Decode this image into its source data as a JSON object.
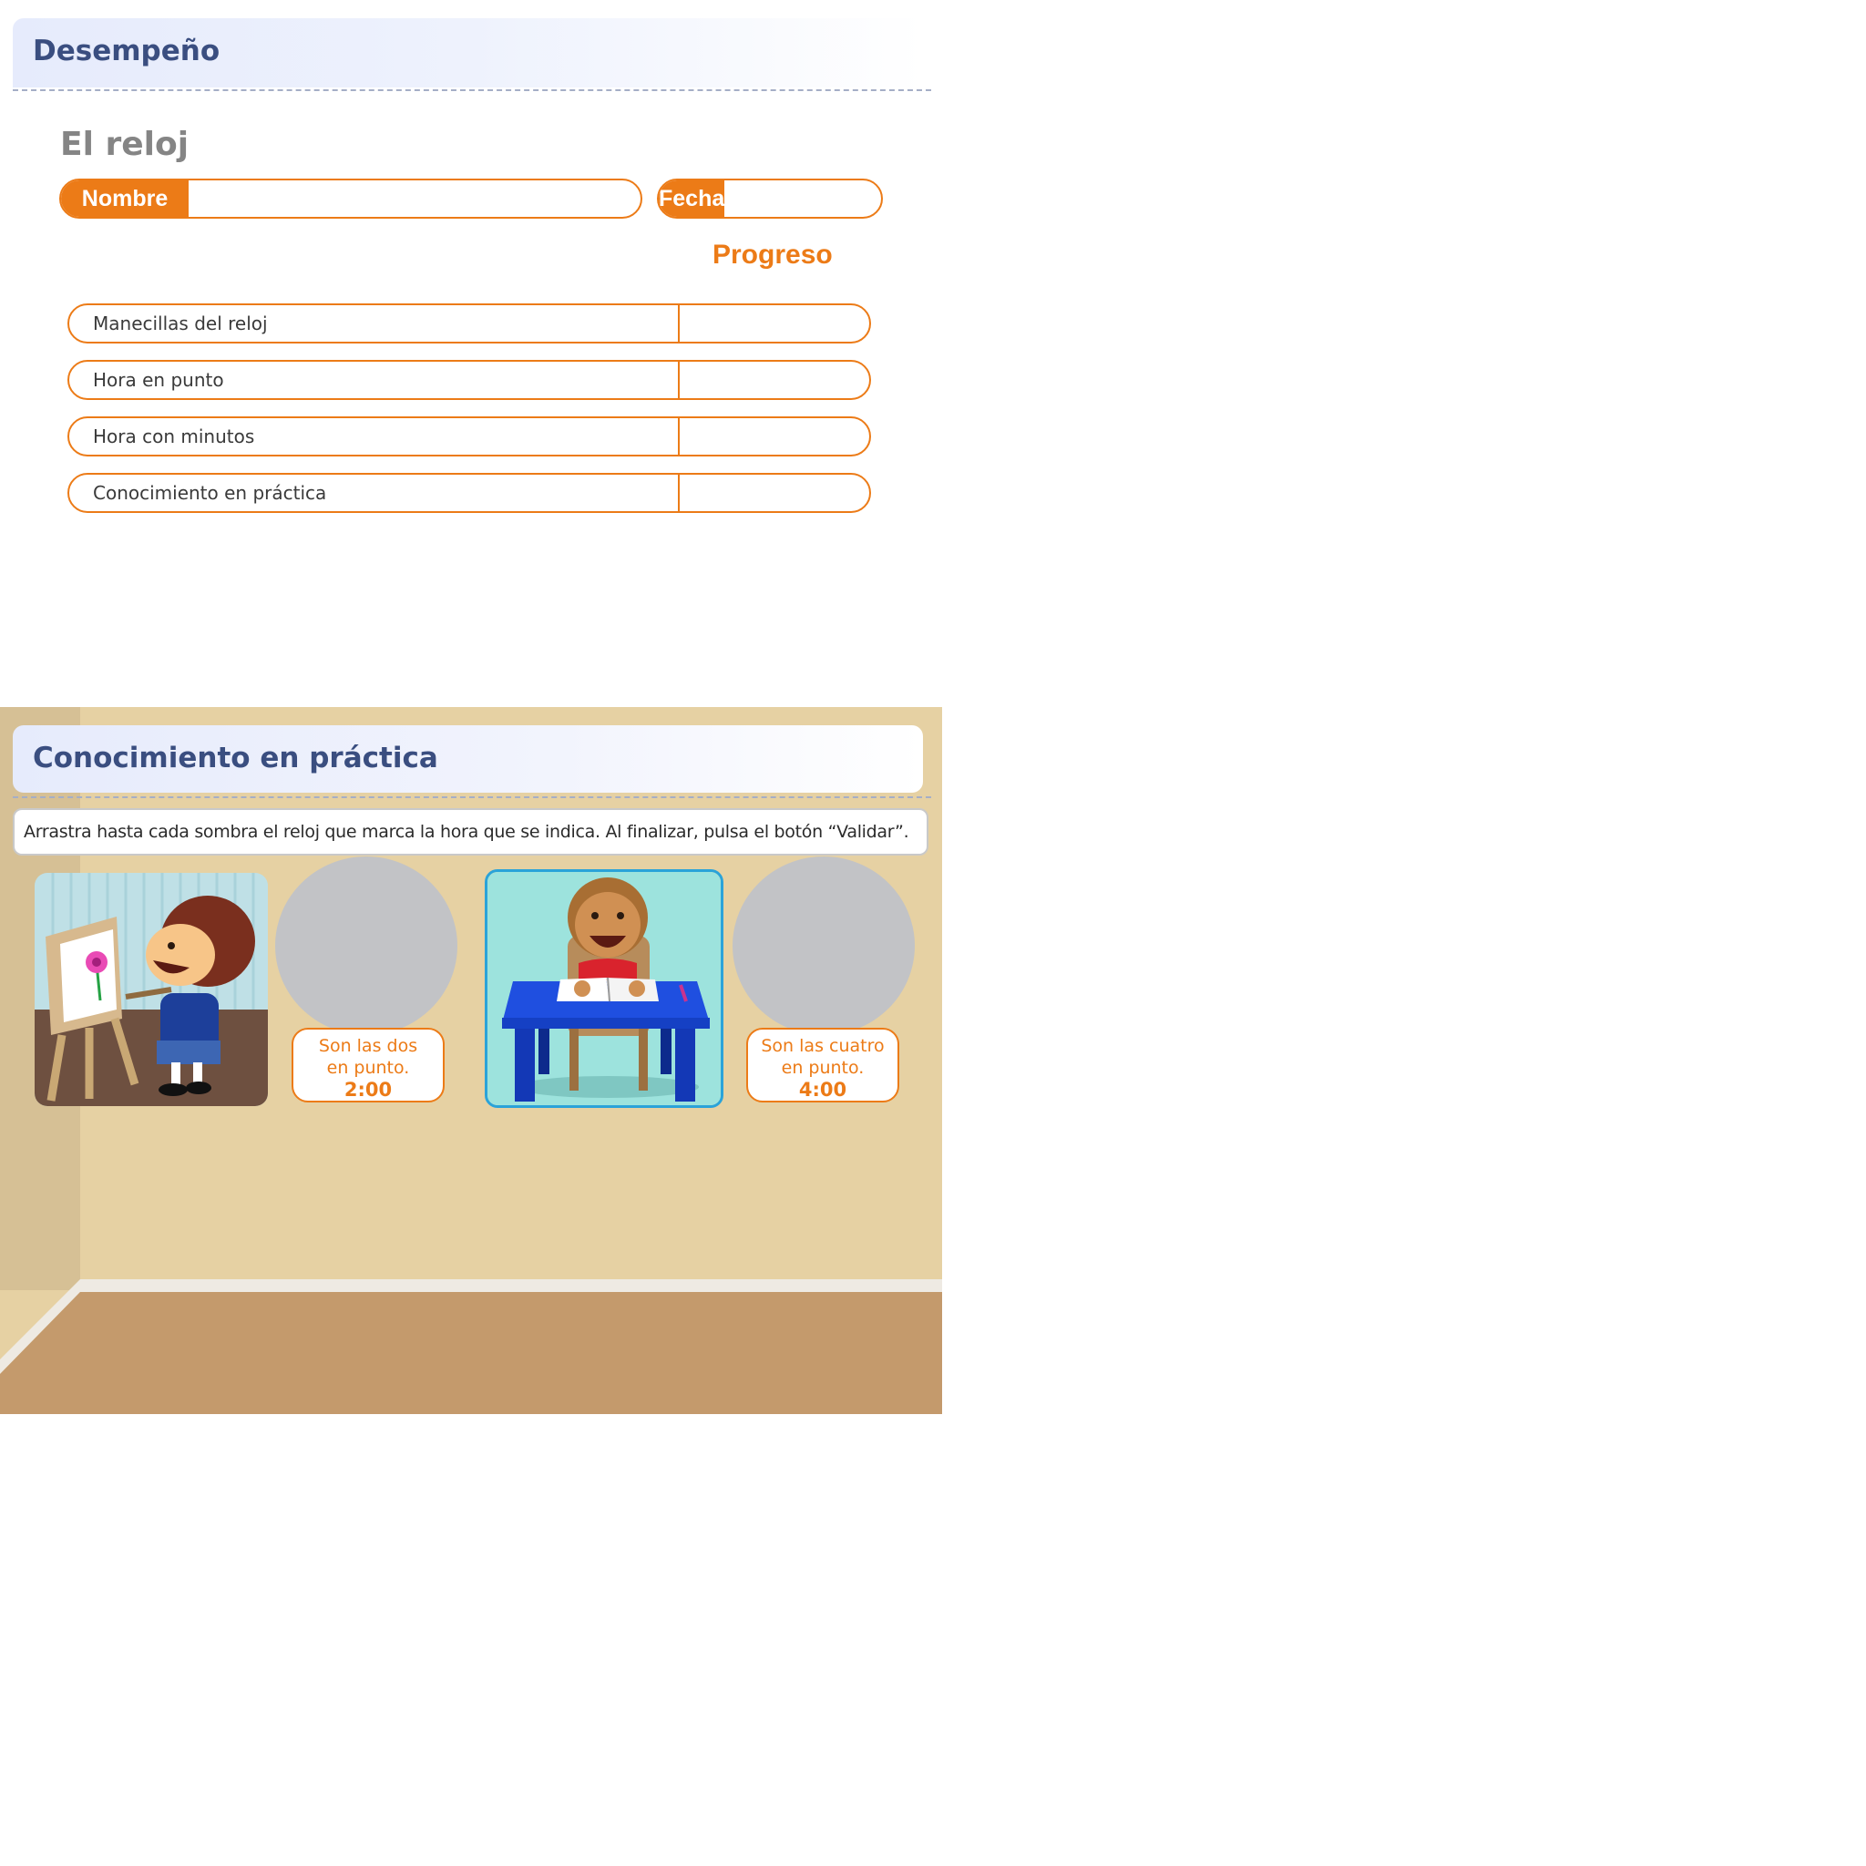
{
  "top_panel": {
    "header_title": "Desempeño",
    "subtitle": "El reloj",
    "name_field": {
      "label": "Nombre",
      "value": ""
    },
    "date_field": {
      "label": "Fecha",
      "value": ""
    },
    "progress_heading": "Progreso",
    "progress_rows": [
      {
        "label": "Manecillas del reloj",
        "value": ""
      },
      {
        "label": "Hora en punto",
        "value": ""
      },
      {
        "label": "Hora con minutos",
        "value": ""
      },
      {
        "label": "Conocimiento en práctica",
        "value": ""
      }
    ]
  },
  "activity": {
    "header_title": "Conocimiento en práctica",
    "instruction": "Arrastra hasta cada sombra el reloj que marca la hora que se indica. Al finalizar, pulsa el botón “Validar”.",
    "items": [
      {
        "scene": "girl-painting-illustration",
        "line1": "Son las dos",
        "line2": "en punto.",
        "time": "2:00"
      },
      {
        "scene": "boy-studying-illustration",
        "line1": "Son las cuatro",
        "line2": "en punto.",
        "time": "4:00"
      }
    ]
  },
  "colors": {
    "accent_orange": "#ec7b17",
    "title_blue": "#3a4e80",
    "wall": "#e6d1a3",
    "floor": "#c49a6c",
    "drop_zone_gray": "#c2c3c6"
  }
}
